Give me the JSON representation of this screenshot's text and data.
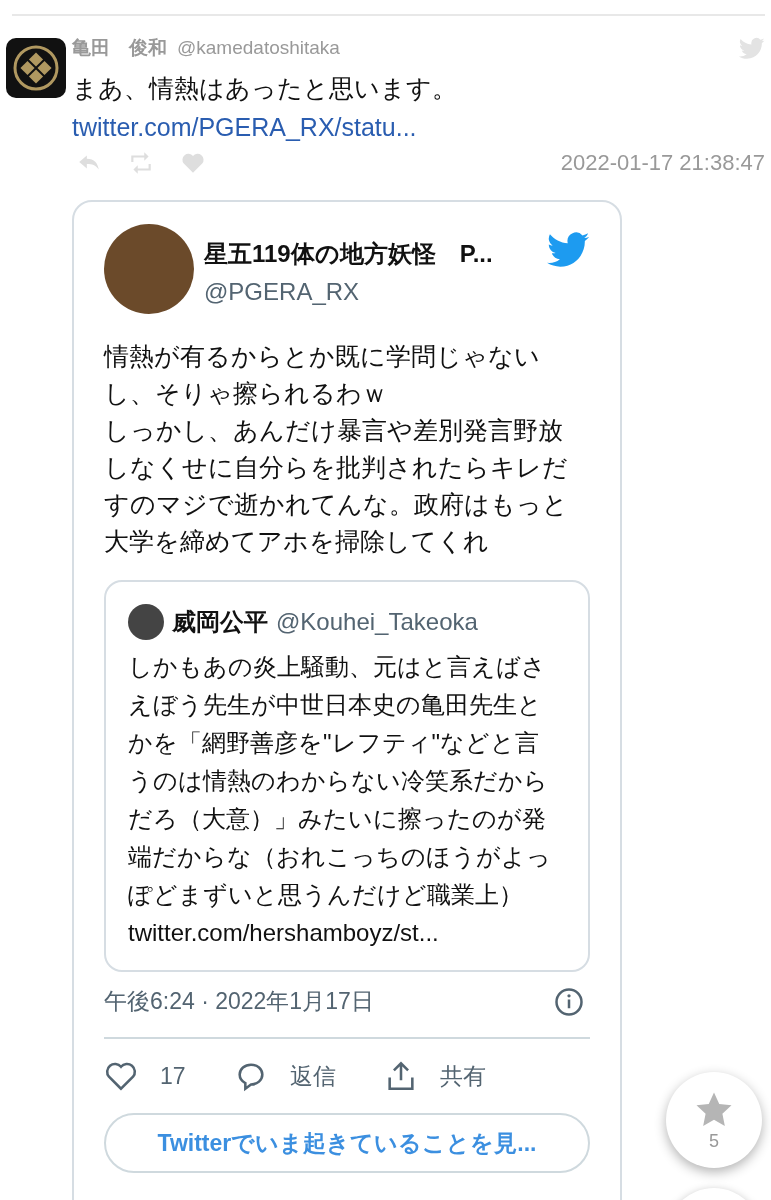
{
  "tweet": {
    "name": "亀田　俊和",
    "handle": "@kamedatoshitaka",
    "text": "まあ、情熱はあったと思います。",
    "link": "twitter.com/PGERA_RX/statu...",
    "timestamp": "2022-01-17 21:38:47"
  },
  "embed": {
    "name": "星五119体の地方妖怪　P...",
    "handle": "@PGERA_RX",
    "lines": [
      "情熱が有るからとか既に学問じゃない",
      "し、そりゃ擦られるわｗ",
      "しっかし、あんだけ暴言や差別発言野放",
      "しなくせに自分らを批判されたらキレだ",
      "すのマジで逝かれてんな。政府はもっと",
      "大学を締めてアホを掃除してくれ"
    ],
    "quote": {
      "name": "威岡公平",
      "handle": "@Kouhei_Takeoka",
      "lines": [
        "しかもあの炎上騒動、元はと言えばさ",
        "えぼう先生が中世日本史の亀田先生と",
        "かを「網野善彦を\"レフティ\"などと言",
        "うのは情熱のわからない冷笑系だから",
        "だろ（大意）」みたいに擦ったのが発",
        "端だからな（おれこっちのほうがよっ",
        "ぽどまずいと思うんだけど職業上）",
        "twitter.com/hershamboyz/st..."
      ]
    },
    "date": "午後6:24 · 2022年1月17日",
    "actions": [
      {
        "kind": "like",
        "label": "17"
      },
      {
        "kind": "reply",
        "label": "返信"
      },
      {
        "kind": "share",
        "label": "共有"
      }
    ],
    "cta": "Twitterでいま起きていることを見..."
  },
  "star_button": {
    "count": "5"
  }
}
